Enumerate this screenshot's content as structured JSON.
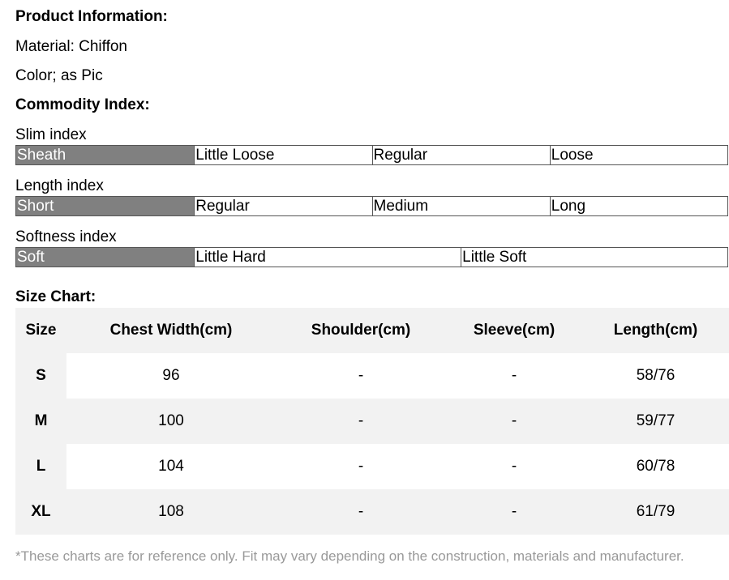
{
  "product_info": {
    "heading": "Product Information:",
    "material": "Material: Chiffon",
    "color": "Color; as Pic"
  },
  "commodity_index": {
    "heading": "Commodity Index:",
    "slim": {
      "label": "Slim index",
      "options": [
        "Sheath",
        "Little Loose",
        "Regular",
        "Loose"
      ],
      "selected": "Sheath"
    },
    "length": {
      "label": "Length index",
      "options": [
        "Short",
        "Regular",
        "Medium",
        "Long"
      ],
      "selected": "Short"
    },
    "softness": {
      "label": "Softness index",
      "options": [
        "Soft",
        "Little Hard",
        "Little Soft"
      ],
      "selected": "Soft"
    },
    "highlight_color": "#808080"
  },
  "size_chart": {
    "heading": "Size Chart:",
    "columns": [
      "Size",
      "Chest Width(cm)",
      "Shoulder(cm)",
      "Sleeve(cm)",
      "Length(cm)"
    ],
    "rows": [
      [
        "S",
        "96",
        "-",
        "-",
        "58/76"
      ],
      [
        "M",
        "100",
        "-",
        "-",
        "59/77"
      ],
      [
        "L",
        "104",
        "-",
        "-",
        "60/78"
      ],
      [
        "XL",
        "108",
        "-",
        "-",
        "61/79"
      ]
    ]
  },
  "footnote": "*These charts are for reference only. Fit may vary depending on the construction, materials and manufacturer."
}
